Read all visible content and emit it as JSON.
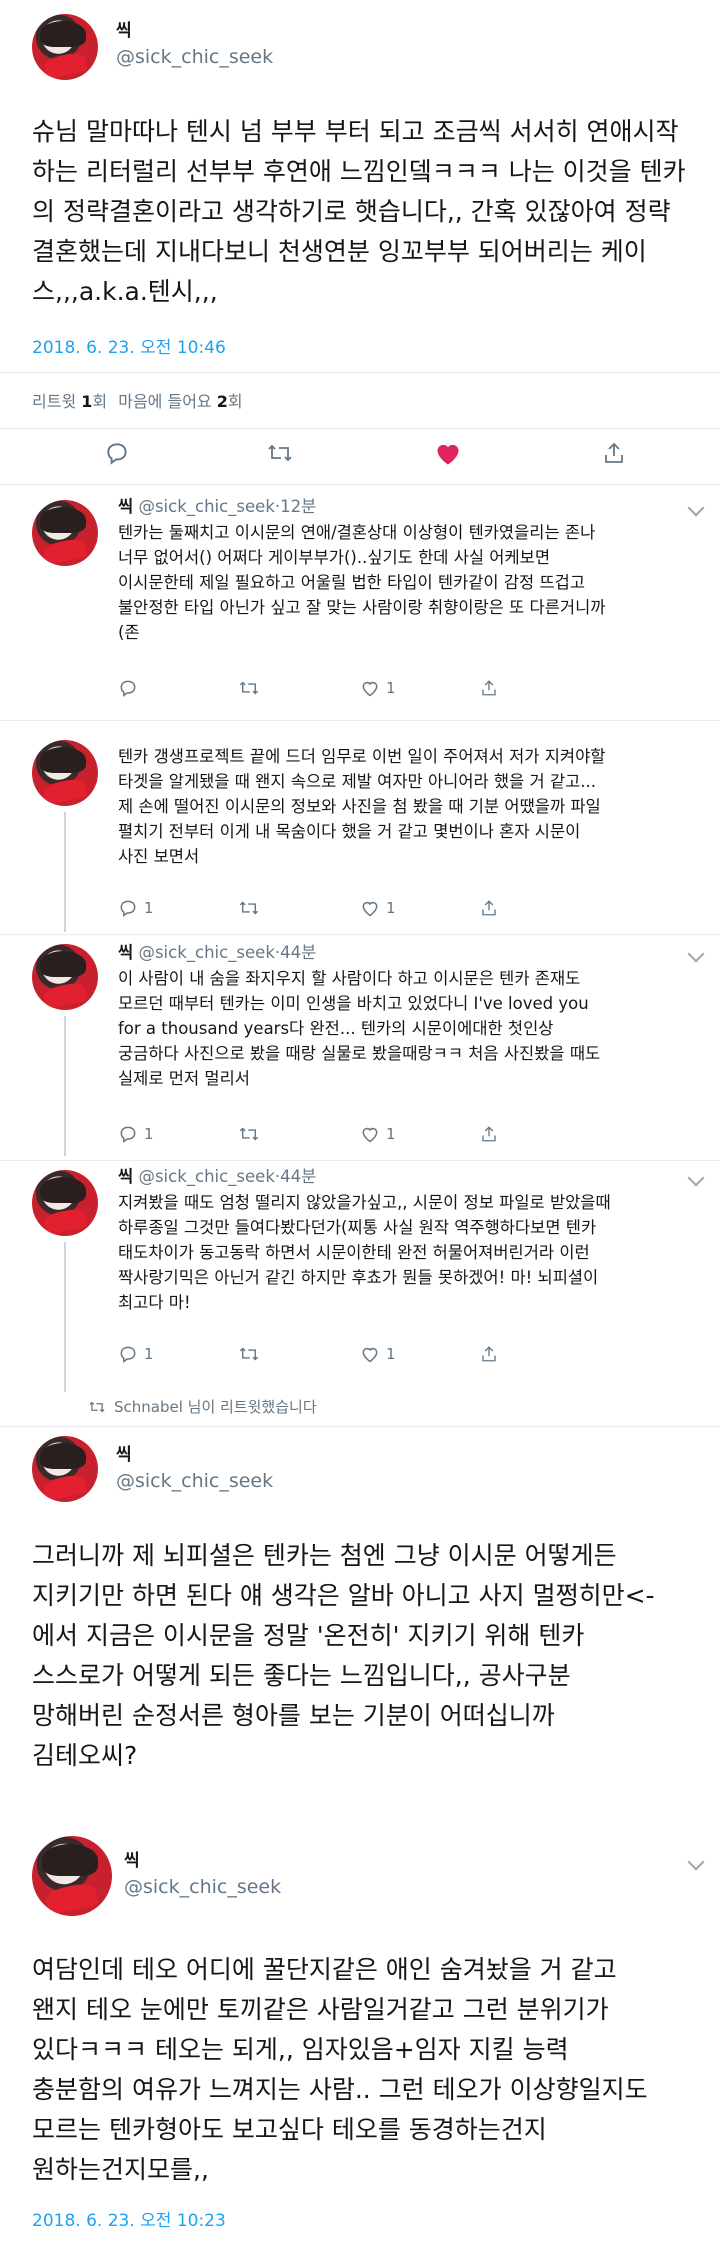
{
  "main": {
    "author": {
      "name": "씩",
      "handle": "@sick_chic_seek"
    },
    "text": "슈님 말마따나 텐시 넘 부부 부터 되고 조금씩 서서히 연애시작하는 리터럴리 선부부 후연애 느낌인뎈ㅋㅋㅋ 나는 이것을 텐카의 정략결혼이라고 생각하기로 햇습니다,, 간혹 있잖아여 정략결혼했는데 지내다보니 천생연분 잉꼬부부 되어버리는 케이스,,,a.k.a.텐시,,,",
    "timestamp": "2018. 6. 23. 오전 10:46",
    "stats": {
      "retweets_label": "리트윗",
      "retweets": "1",
      "retweets_unit": "회",
      "likes_label": "마음에 들어요",
      "likes": "2",
      "likes_unit": "회"
    }
  },
  "replies": [
    {
      "name": "씩",
      "handle": "@sick_chic_seek",
      "time": "12분",
      "lines": [
        "텐카는 둘째치고 이시문의 연애/결혼상대 이상형이 텐카였을리는 존나",
        "너무 없어서() 어쩌다 게이부부가()..싶기도 한데 사실 어케보면",
        "이시문한테 제일 필요하고 어울릴 법한 타입이 텐카같이 감정 뜨겁고",
        "불안정한 타입 아닌가 싶고 잘 맞는 사람이랑 취향이랑은 또 다른거니까",
        "(존"
      ],
      "like": "1",
      "reply": ""
    },
    {
      "name": "",
      "handle": "",
      "time": "",
      "lines": [
        "텐카 갱생프로젝트 끝에 드더 임무로 이번 일이 주어져서 저가 지켜야할",
        "타겟을 알게됐을 때 왠지 속으로 제발 여자만 아니어라 했을 거 같고...",
        "제 손에 떨어진 이시문의 정보와 사진을 첨 봤을 때 기분 어땠을까 파일",
        "펼치기 전부터 이게 내 목숨이다 했을 거 같고 몇번이나 혼자 시문이",
        "사진 보면서"
      ],
      "like": "1",
      "reply": "1"
    },
    {
      "name": "씩",
      "handle": "@sick_chic_seek",
      "time": "44분",
      "lines": [
        "이 사람이 내 숨을 좌지우지 할 사람이다 하고 이시문은 텐카 존재도",
        "모르던 때부터 텐카는 이미 인생을 바치고 있었다니 I've loved you",
        "for a thousand years다 완전... 텐카의 시문이에대한 첫인상",
        "궁금하다 사진으로 봤을 때랑 실물로 봤을때랑ㅋㅋ 처음 사진봤을 때도",
        "실제로 먼저 멀리서"
      ],
      "like": "1",
      "reply": "1"
    },
    {
      "name": "씩",
      "handle": "@sick_chic_seek",
      "time": "44분",
      "lines": [
        "지켜봤을 때도 엄청 떨리지 않았을가싶고,, 시문이 정보 파일로 받았을때",
        "하루종일 그것만 들여다봤다던가(찌통 사실 원작 역주행하다보면 텐카",
        "태도차이가 동고동락 하면서 시문이한테 완전 허물어져버린거라 이런",
        "짝사랑기믹은 아닌거 같긴 하지만 후쵸가 뭔들 못하겠어! 마! 뇌피셜이",
        "최고다 마!"
      ],
      "like": "1",
      "reply": "1"
    }
  ],
  "retweet_notice": "Schnabel 님이 리트윗했습니다",
  "tweet2": {
    "name": "씩",
    "handle": "@sick_chic_seek",
    "lines": [
      "그러니까 제 뇌피셜은 텐카는 첨엔 그냥 이시문 어떻게든",
      "지키기만 하면 된다 얘 생각은 알바 아니고 사지 멀쩡히만<-",
      "에서 지금은 이시문을 정말 '온전히' 지키기 위해 텐카",
      "스스로가 어떻게 되든 좋다는 느낌입니다,, 공사구분",
      "망해버린 순정서른 형아를 보는 기분이 어떠십니까",
      "김테오씨?"
    ]
  },
  "tweet3": {
    "name": "씩",
    "handle": "@sick_chic_seek",
    "lines": [
      "여담인데 테오 어디에 꿀단지같은 애인 숨겨놨을 거 같고",
      "왠지 테오 눈에만 토끼같은 사람일거같고 그런 분위기가",
      "있다ㅋㅋㅋ 테오는 되게,, 임자있음+임자 지킬 능력",
      "충분함의 여유가 느껴지는 사람.. 그런 테오가 이상향일지도",
      "모르는 텐카형아도 보고싶다 테오를 동경하는건지",
      "원하는건지모를,,"
    ],
    "timestamp": "2018. 6. 23. 오전 10:23"
  },
  "colors": {
    "accent": "#1da1f2",
    "like": "#e0245e",
    "meta": "#657786",
    "divider": "#e6ecf0"
  }
}
